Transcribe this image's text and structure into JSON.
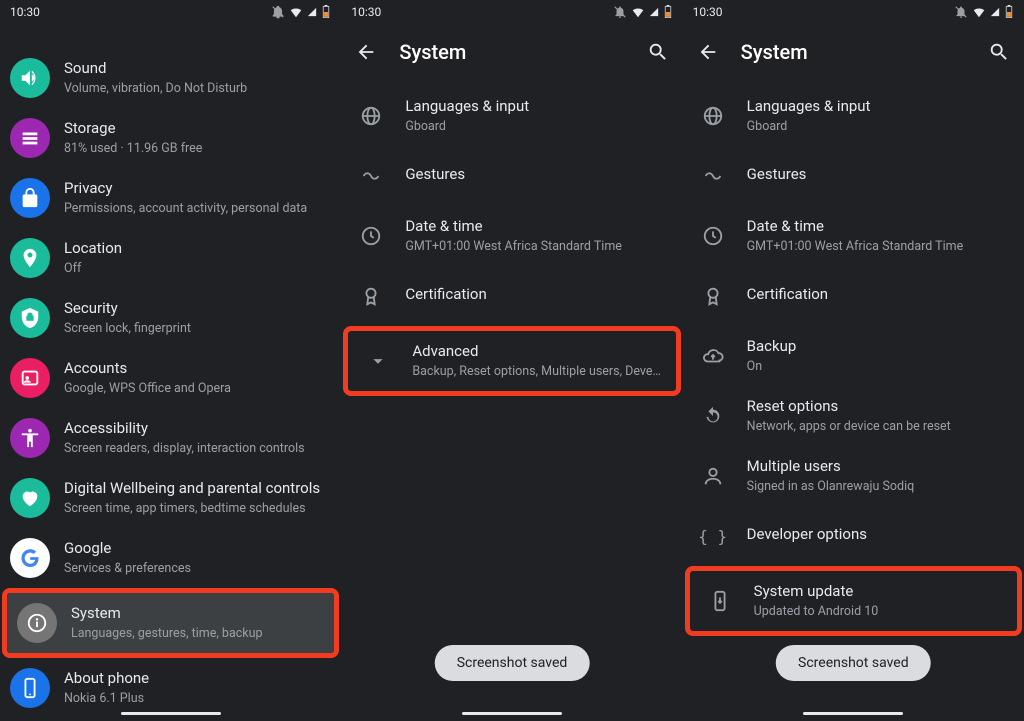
{
  "status": {
    "time": "10:30"
  },
  "panel1": {
    "items": [
      {
        "title": "Sound",
        "sub": "Volume, vibration, Do Not Disturb",
        "color": "#1bbc9c"
      },
      {
        "title": "Storage",
        "sub": "81% used · 11.96 GB free",
        "color": "#9c27b0"
      },
      {
        "title": "Privacy",
        "sub": "Permissions, account activity, personal data",
        "color": "#1a73e8"
      },
      {
        "title": "Location",
        "sub": "Off",
        "color": "#1bbc9c"
      },
      {
        "title": "Security",
        "sub": "Screen lock, fingerprint",
        "color": "#1bbc9c"
      },
      {
        "title": "Accounts",
        "sub": "Google, WPS Office and Opera",
        "color": "#e91e63"
      },
      {
        "title": "Accessibility",
        "sub": "Screen readers, display, interaction controls",
        "color": "#9c27b0"
      },
      {
        "title": "Digital Wellbeing and parental controls",
        "sub": "Screen time, app timers, bedtime schedules",
        "color": "#1bbc9c"
      },
      {
        "title": "Google",
        "sub": "Services & preferences",
        "color": "#ffffff"
      },
      {
        "title": "System",
        "sub": "Languages, gestures, time, backup",
        "color": "#757575"
      },
      {
        "title": "About phone",
        "sub": "Nokia 6.1 Plus",
        "color": "#1a73e8"
      }
    ]
  },
  "panel2": {
    "title": "System",
    "items": [
      {
        "title": "Languages & input",
        "sub": "Gboard"
      },
      {
        "title": "Gestures",
        "sub": ""
      },
      {
        "title": "Date & time",
        "sub": "GMT+01:00 West Africa Standard Time"
      },
      {
        "title": "Certification",
        "sub": ""
      },
      {
        "title": "Advanced",
        "sub": "Backup, Reset options, Multiple users, Developer o.."
      }
    ],
    "toast": "Screenshot saved"
  },
  "panel3": {
    "title": "System",
    "items": [
      {
        "title": "Languages & input",
        "sub": "Gboard"
      },
      {
        "title": "Gestures",
        "sub": ""
      },
      {
        "title": "Date & time",
        "sub": "GMT+01:00 West Africa Standard Time"
      },
      {
        "title": "Certification",
        "sub": ""
      },
      {
        "title": "Backup",
        "sub": "On"
      },
      {
        "title": "Reset options",
        "sub": "Network, apps or device can be reset"
      },
      {
        "title": "Multiple users",
        "sub": "Signed in as Olanrewaju Sodiq"
      },
      {
        "title": "Developer options",
        "sub": ""
      },
      {
        "title": "System update",
        "sub": "Updated to Android 10"
      }
    ],
    "toast": "Screenshot saved"
  }
}
